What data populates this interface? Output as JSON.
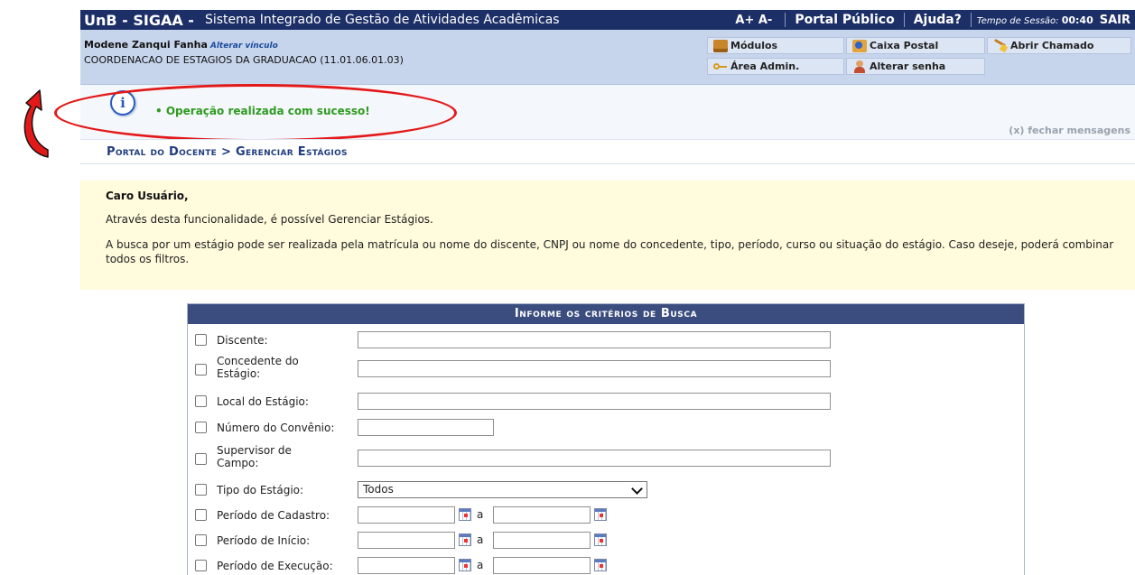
{
  "header": {
    "brand": "UnB - SIGAA -",
    "system_name": "Sistema Integrado de Gestão de Atividades Acadêmicas",
    "font_controls": "A+ A-",
    "portal_publico": "Portal Público",
    "ajuda": "Ajuda?",
    "session_label": "Tempo de Sessão:",
    "session_time": "00:40",
    "sair": "SAIR"
  },
  "user": {
    "name": "Modene Zanqui Fanha",
    "alterar_vinculo": "Alterar vínculo",
    "unit": "COORDENACAO DE ESTAGIOS DA GRADUACAO (11.01.06.01.03)"
  },
  "quick_buttons": {
    "modulos": "Módulos",
    "caixa_postal": "Caixa Postal",
    "abrir_chamado": "Abrir Chamado",
    "area_admin": "Área Admin.",
    "alterar_senha": "Alterar senha"
  },
  "messages": {
    "success": "Operação realizada com sucesso!",
    "close": "(x) fechar mensagens",
    "info_glyph": "i"
  },
  "breadcrumb": "Portal do Docente > Gerenciar Estágios",
  "description": {
    "heading": "Caro Usuário,",
    "p1": "Através desta funcionalidade, é possível Gerenciar Estágios.",
    "p2": "A busca por um estágio pode ser realizada pela matrícula ou nome do discente, CNPJ ou nome do concedente, tipo, período, curso ou situação do estágio. Caso deseje, poderá combinar todos os filtros."
  },
  "form": {
    "title": "Informe os critérios de Busca",
    "labels": {
      "discente": "Discente:",
      "concedente": "Concedente do Estágio:",
      "local": "Local do Estágio:",
      "numero_convenio": "Número do Convênio:",
      "supervisor": "Supervisor de Campo:",
      "tipo": "Tipo do Estágio:",
      "periodo_cadastro": "Período de Cadastro:",
      "periodo_inicio": "Período de Início:",
      "periodo_execucao": "Período de Execução:"
    },
    "tipo_selected": "Todos",
    "range_sep": "a"
  },
  "colors": {
    "topbar": "#1c2f67",
    "userbar": "#c7d5ec",
    "success": "#2e9a1f",
    "annotation": "#e31919",
    "form_header": "#3b4d7e"
  }
}
